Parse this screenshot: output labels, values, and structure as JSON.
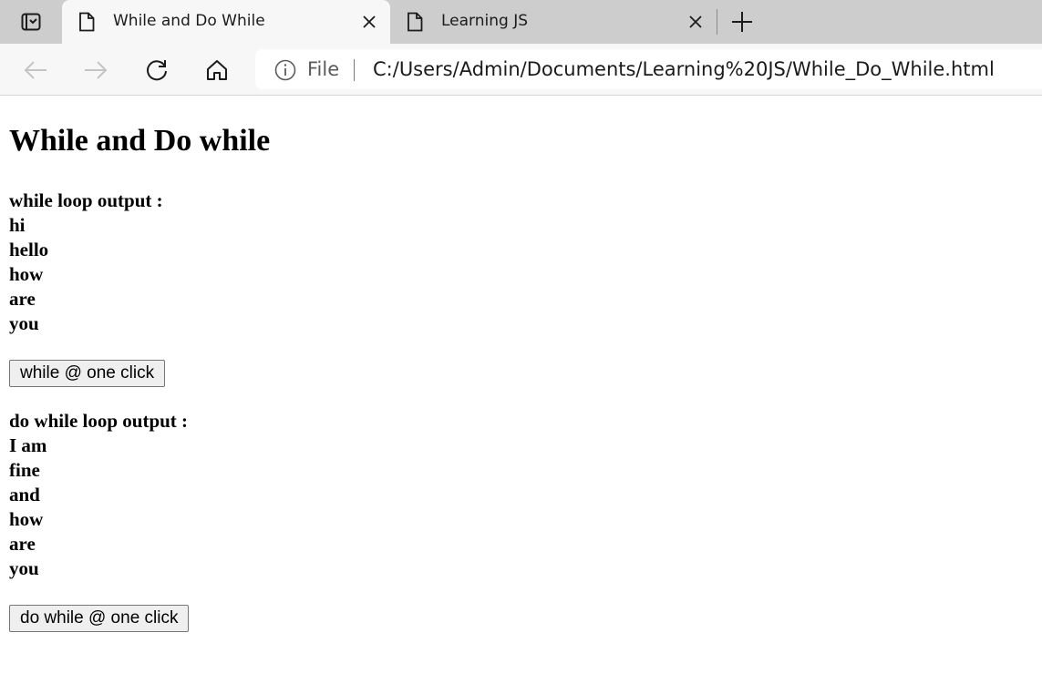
{
  "browser": {
    "tabs": [
      {
        "title": "While and Do While",
        "active": true
      },
      {
        "title": "Learning JS",
        "active": false
      }
    ],
    "address": {
      "scheme_label": "File",
      "url": "C:/Users/Admin/Documents/Learning%20JS/While_Do_While.html"
    },
    "icons": [
      "tab-actions-icon",
      "page-icon",
      "close-icon",
      "new-tab-icon",
      "back-icon",
      "forward-icon",
      "refresh-icon",
      "home-icon",
      "info-icon"
    ]
  },
  "page": {
    "heading": "While and Do while",
    "while_section": {
      "label": "while loop output :",
      "lines": [
        "hi",
        "hello",
        "how",
        "are",
        "you"
      ],
      "button_label": "while @ one click"
    },
    "do_while_section": {
      "label": "do while loop output :",
      "lines": [
        "I am",
        "fine",
        "and",
        "how",
        "are",
        "you"
      ],
      "button_label": "do while @ one click"
    }
  },
  "colors": {
    "tabstrip": "#cdcdcd",
    "toolbar": "#f7f7f7",
    "button_bg": "#efefef",
    "button_border": "#767676"
  }
}
